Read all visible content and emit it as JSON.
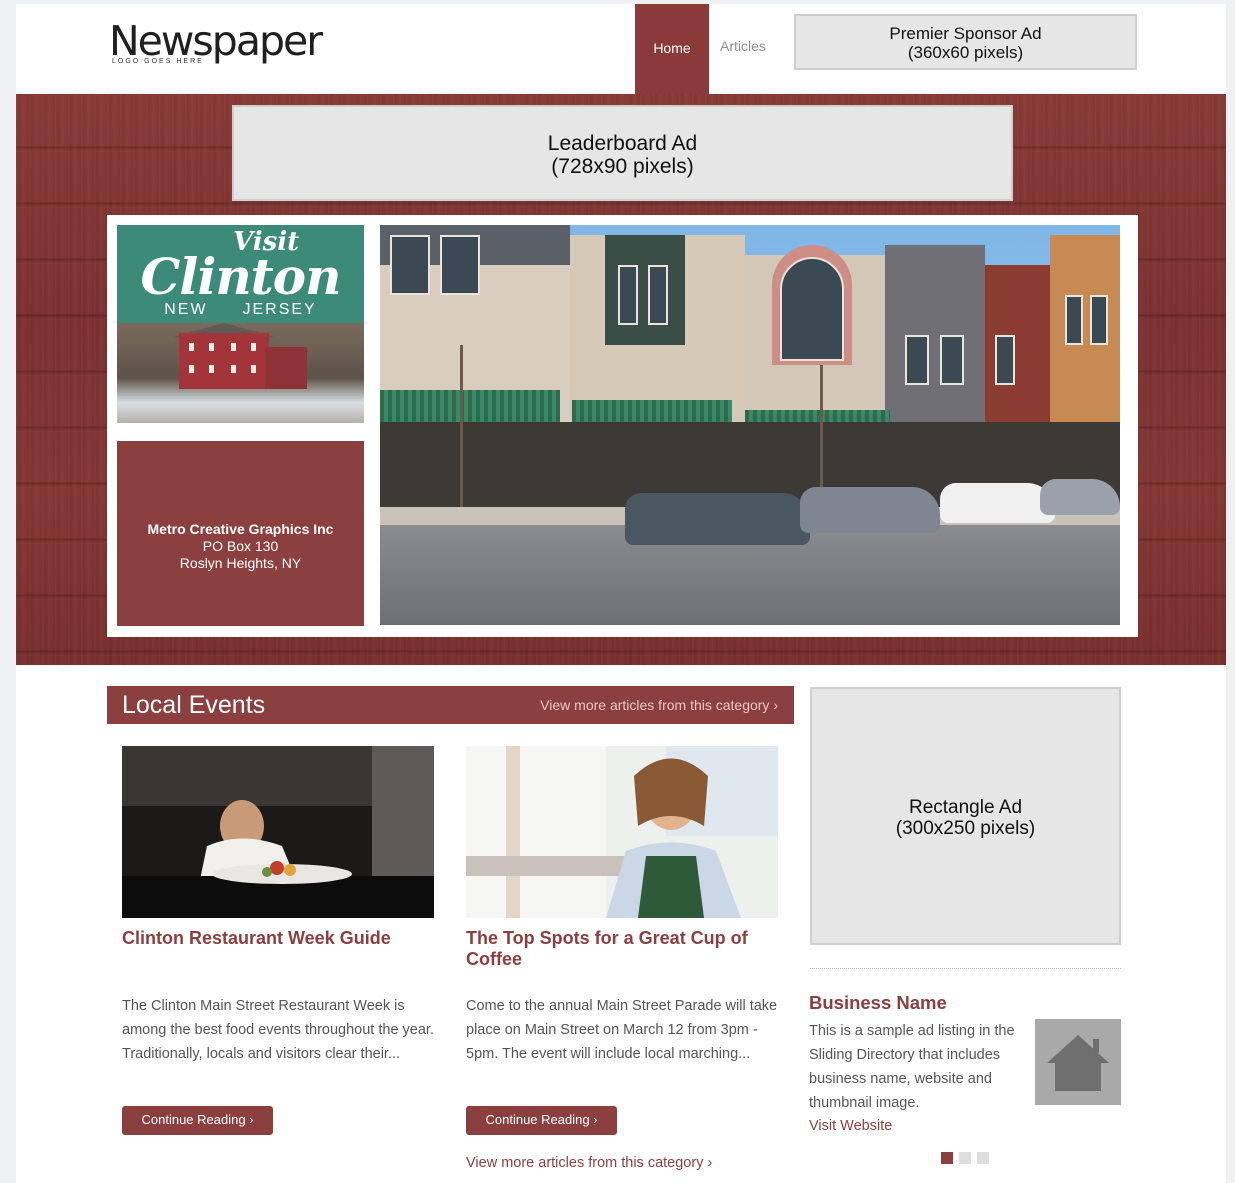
{
  "header": {
    "logo_text": "Newspaper",
    "logo_tagline": "LOGO GOES HERE",
    "nav": [
      {
        "label": "Home",
        "active": true
      },
      {
        "label": "Articles",
        "active": false
      }
    ],
    "sponsor_ad": {
      "line1": "Premier Sponsor Ad",
      "line2": "(360x60 pixels)"
    }
  },
  "hero": {
    "leaderboard_ad": {
      "line1": "Leaderboard Ad",
      "line2": "(728x90 pixels)"
    },
    "visit_card": {
      "small": "Visit",
      "big": "Clinton",
      "state_left": "NEW",
      "state_right": "JERSEY"
    },
    "address": {
      "name": "Metro Creative Graphics Inc",
      "line1": "PO Box 130",
      "line2": "Roslyn Heights, NY"
    }
  },
  "section": {
    "title": "Local Events",
    "more_link": "View more articles from this category ›"
  },
  "articles": [
    {
      "title": "Clinton Restaurant Week Guide",
      "body": "The Clinton Main Street Restaurant Week is among the best food events throughout the year. Traditionally, locals and visitors clear their...",
      "button": "Continue Reading ›"
    },
    {
      "title": "The Top Spots for a Great Cup of Coffee",
      "body": "Come to the annual Main Street Parade will take place on Main Street on March 12 from 3pm - 5pm.  The event will include local marching...",
      "button": "Continue Reading ›"
    }
  ],
  "bottom_more_link": "View more articles from this category ›",
  "sidebar": {
    "rectangle_ad": {
      "line1": "Rectangle Ad",
      "line2": "(300x250 pixels)"
    },
    "business": {
      "name": "Business Name",
      "description": "This is a sample ad listing in the Sliding Directory that includes business name, website and thumbnail image.",
      "link": "Visit Website"
    },
    "slider_pages": 3,
    "slider_active": 1
  },
  "colors": {
    "brand": "#8b3f3e",
    "ad_fill": "#e6e6e6",
    "visit_teal": "#3c8b79",
    "dot_inactive": "#dedede"
  },
  "icons": {
    "home_thumbnail": "house-icon"
  }
}
